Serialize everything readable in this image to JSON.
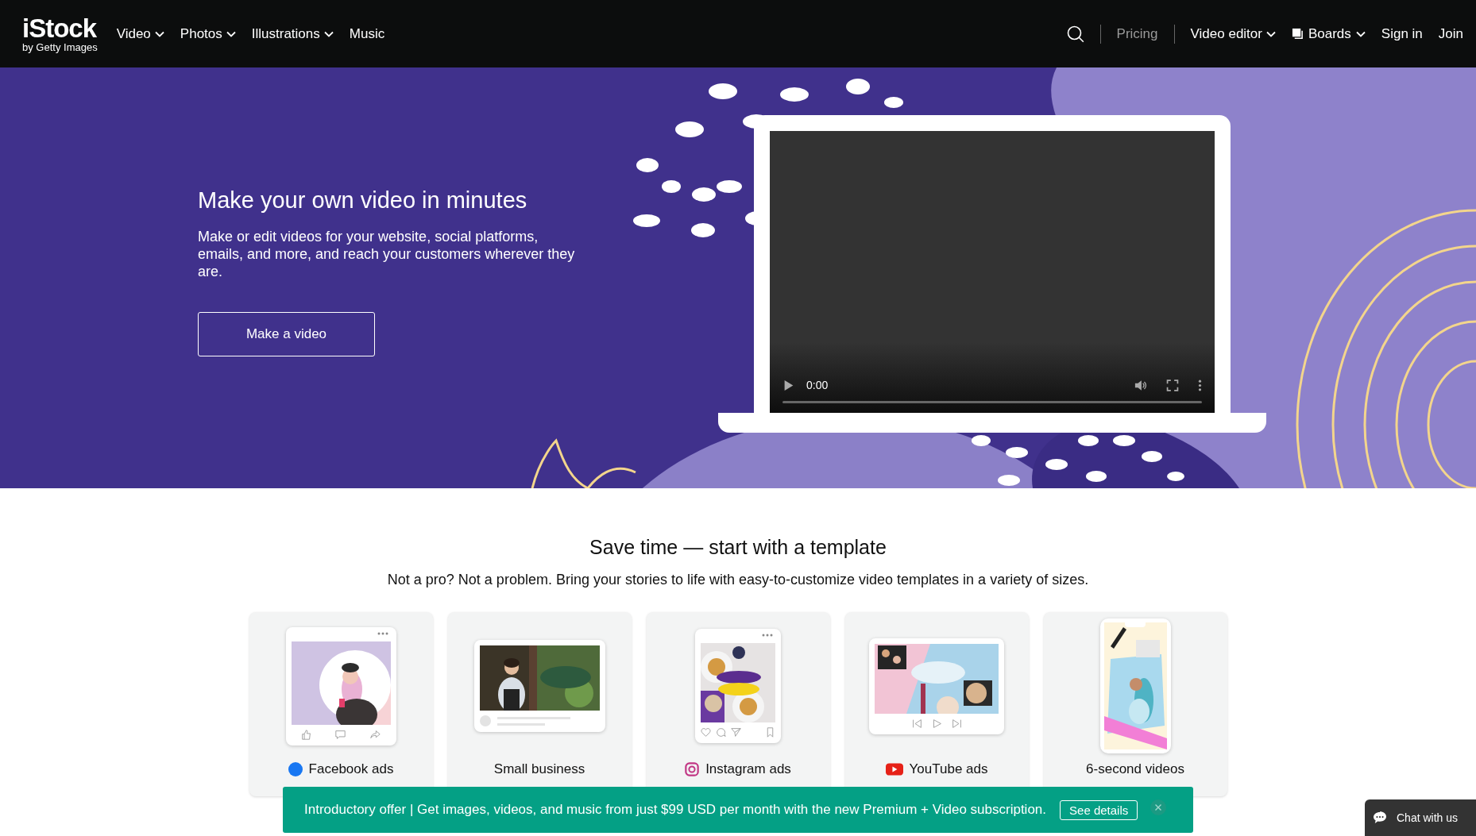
{
  "header": {
    "logo": {
      "name": "iStock",
      "tagline": "by Getty Images"
    },
    "nav": [
      {
        "label": "Video",
        "dropdown": true
      },
      {
        "label": "Photos",
        "dropdown": true
      },
      {
        "label": "Illustrations",
        "dropdown": true
      },
      {
        "label": "Music",
        "dropdown": false
      }
    ],
    "right": [
      {
        "kind": "search"
      },
      {
        "kind": "link",
        "label": "Pricing",
        "dimmed": true
      },
      {
        "kind": "dropdown",
        "label": "Video editor",
        "dimmed": false
      },
      {
        "kind": "boards",
        "label": "Boards",
        "dimmed": false
      },
      {
        "kind": "link",
        "label": "Sign in",
        "dimmed": false
      },
      {
        "kind": "link",
        "label": "Join",
        "dimmed": false
      }
    ]
  },
  "hero": {
    "title": "Make your own video in minutes",
    "text": "Make or edit videos for your website, social platforms, emails, and more, and reach your customers wherever they are.",
    "button": "Make a video",
    "player": {
      "time": "0:00"
    }
  },
  "templates": {
    "heading": "Save time — start with a template",
    "subheading": "Not a pro? Not a problem. Bring your stories to life with easy-to-customize video templates in a variety of sizes.",
    "cards": [
      {
        "kind": "facebook",
        "label": "Facebook ads"
      },
      {
        "kind": "feed",
        "label": "Small business"
      },
      {
        "kind": "instagram",
        "label": "Instagram ads"
      },
      {
        "kind": "youtube",
        "label": "YouTube ads"
      },
      {
        "kind": "story",
        "label": "6-second videos"
      }
    ]
  },
  "banner": {
    "text": "Introductory offer | Get images, videos, and music from just $99 USD per month with the new Premium + Video subscription.",
    "button": "See details"
  },
  "chat": {
    "label": "Chat with us"
  }
}
